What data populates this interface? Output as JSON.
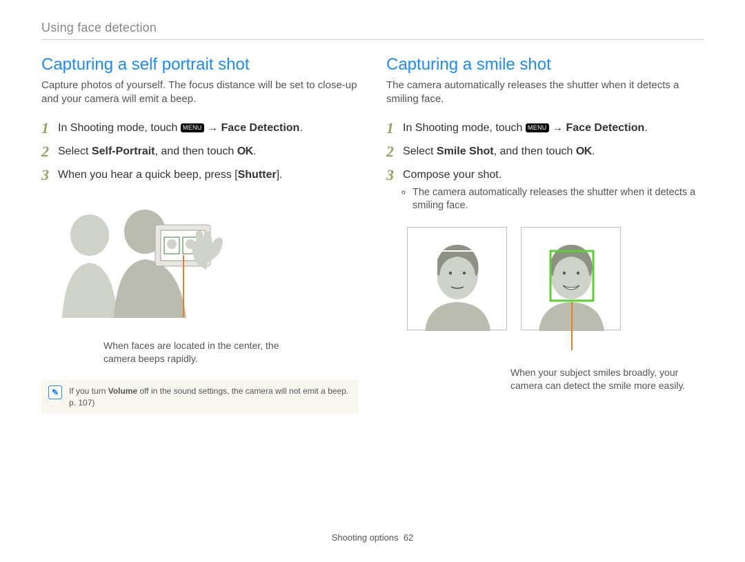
{
  "breadcrumb": "Using face detection",
  "left": {
    "heading": "Capturing a self portrait shot",
    "intro": "Capture photos of yourself. The focus distance will be set to close-up and your camera will emit a beep.",
    "steps": {
      "s1_a": "In Shooting mode, touch ",
      "s1_menu": "MENU",
      "s1_b": " → ",
      "s1_bold": "Face Detection",
      "s1_c": ".",
      "s2_a": "Select ",
      "s2_bold": "Self-Portrait",
      "s2_b": ", and then touch ",
      "s2_ok": "OK",
      "s2_c": ".",
      "s3_a": "When you hear a quick beep, press [",
      "s3_bold": "Shutter",
      "s3_b": "]."
    },
    "caption": "When faces are located in the center, the camera beeps rapidly.",
    "note_prefix": "If you turn ",
    "note_bold": "Volume",
    "note_suffix": " off in the sound settings, the camera will not emit a beep. p. 107)"
  },
  "right": {
    "heading": "Capturing a smile shot",
    "intro": "The camera automatically releases the shutter when it detects a smiling face.",
    "steps": {
      "s1_a": "In Shooting mode, touch ",
      "s1_menu": "MENU",
      "s1_b": " → ",
      "s1_bold": "Face Detection",
      "s1_c": ".",
      "s2_a": "Select ",
      "s2_bold": "Smile Shot",
      "s2_b": ", and then touch ",
      "s2_ok": "OK",
      "s2_c": ".",
      "s3": "Compose your shot.",
      "s3_sub": "The camera automatically releases the shutter when it detects a smiling face."
    },
    "caption": "When your subject smiles broadly, your camera can detect the smile more easily."
  },
  "footer": {
    "section": "Shooting options",
    "page": "62"
  },
  "icons": {
    "note": "✎"
  }
}
